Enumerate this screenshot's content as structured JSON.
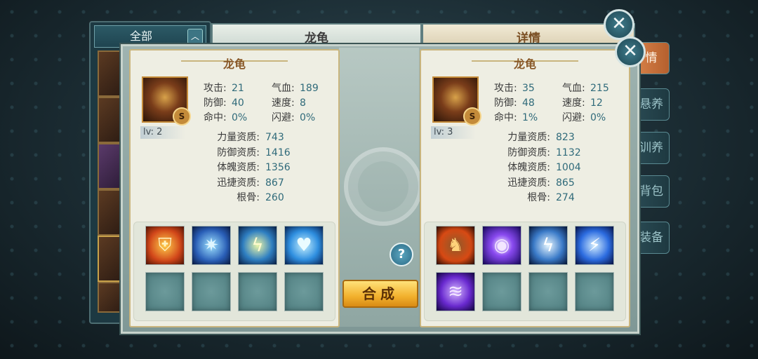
{
  "back": {
    "filter_label": "全部",
    "filter_arrow": "︿",
    "center_title": "龙龟",
    "right_title": "详情",
    "side_tabs": [
      "情",
      "悬养",
      "训养",
      "背包",
      "装备"
    ]
  },
  "left_card": {
    "name": "龙龟",
    "rank": "S",
    "level": "lv: 2",
    "stats": [
      {
        "k": "攻击:",
        "v": "21",
        "k2": "气血:",
        "v2": "189"
      },
      {
        "k": "防御:",
        "v": "40",
        "k2": "速度:",
        "v2": "8"
      },
      {
        "k": "命中:",
        "v": "0%",
        "k2": "闪避:",
        "v2": "0%"
      }
    ],
    "aptitudes": [
      {
        "k": "力量资质:",
        "v": "743"
      },
      {
        "k": "防御资质:",
        "v": "1416"
      },
      {
        "k": "体魄资质:",
        "v": "1356"
      },
      {
        "k": "迅捷资质:",
        "v": "867"
      },
      {
        "k": "根骨:",
        "v": "260"
      }
    ],
    "skills": [
      "shield-fire-icon",
      "ice-shard-icon",
      "lightning-slash-icon",
      "water-orb-icon"
    ]
  },
  "right_card": {
    "name": "龙龟",
    "rank": "S",
    "level": "lv: 3",
    "stats": [
      {
        "k": "攻击:",
        "v": "35",
        "k2": "气血:",
        "v2": "215"
      },
      {
        "k": "防御:",
        "v": "48",
        "k2": "速度:",
        "v2": "12"
      },
      {
        "k": "命中:",
        "v": "1%",
        "k2": "闪避:",
        "v2": "0%"
      }
    ],
    "aptitudes": [
      {
        "k": "力量资质:",
        "v": "823"
      },
      {
        "k": "防御资质:",
        "v": "1132"
      },
      {
        "k": "体魄资质:",
        "v": "1004"
      },
      {
        "k": "迅捷资质:",
        "v": "865"
      },
      {
        "k": "根骨:",
        "v": "274"
      }
    ],
    "skills": [
      "beast-roar-icon",
      "arcane-orb-icon",
      "thunder-storm-icon",
      "lightning-bolt-icon",
      "purple-tornado-icon"
    ]
  },
  "buttons": {
    "merge": "合成",
    "help": "?",
    "close": "✕"
  }
}
